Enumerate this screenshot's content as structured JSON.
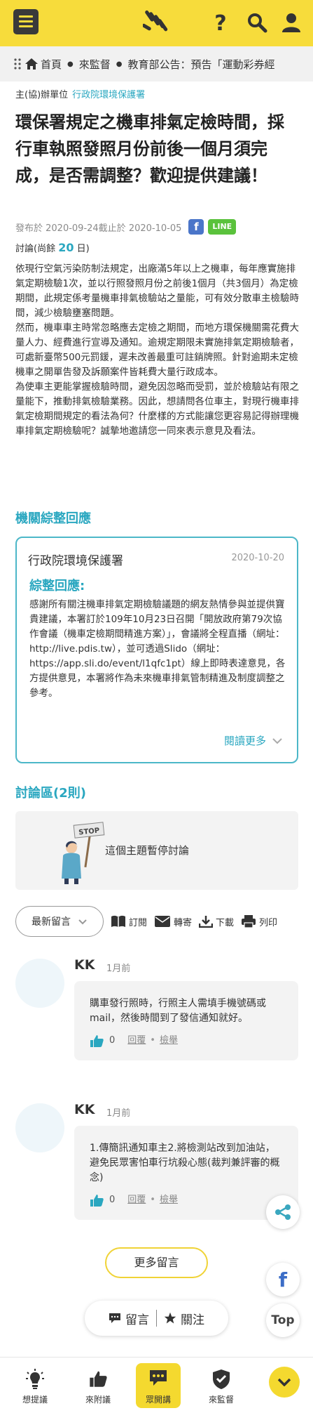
{
  "header": {
    "logo_icon": "hand-logo-icon",
    "accent": "#f7dc3b"
  },
  "breadcrumb": {
    "home": "首頁",
    "section": "來監督",
    "current": "教育部公告：預告「運動彩券經"
  },
  "org": {
    "label": "主(協)辦單位",
    "name": "行政院環境保護署"
  },
  "title": "環保署規定之機車排氣定檢時間，採行車執照發照月份前後一個月須完成，是否需調整？歡迎提供建議！",
  "meta": {
    "published": "發布於 2020-09-24截止於 2020-10-05",
    "fb": "f",
    "line": "LINE"
  },
  "discuss": {
    "prefix": "討論(尚餘 ",
    "days": "20",
    "suffix": " 日)"
  },
  "body": [
    "依現行空氣污染防制法規定，出廠滿5年以上之機車，每年應實施排氣定期檢驗1次，並以行照發照月份之前後1個月（共3個月）為定檢期間，此規定係考量機車排氣檢驗站之量能，可有效分散車主檢驗時間，減少檢驗壅塞問題。",
    "然而，機車車主時常忽略應去定檢之期間，而地方環保機關需花費大量人力、經費進行宣導及通知。逾規定期限未實施排氣定期檢驗者，可處新臺幣500元罰鍰，遲未改善最重可註銷牌照。針對逾期未定檢機車之開單告發及訴願案件皆耗費大量行政成本。",
    "為使車主更能掌握檢驗時間，避免因忽略而受罰，並於檢驗站有限之量能下，推動排氣檢驗業務。因此，想請問各位車主，對現行機車排氣定檢期間規定的看法為何？什麼樣的方式能讓您更容易記得辦理機車排氣定期檢驗呢？誠摯地邀請您一同來表示意見及看法。"
  ],
  "response": {
    "section_title": "機關綜整回應",
    "org": "行政院環境保護署",
    "date": "2020-10-20",
    "label": "綜整回應:",
    "text": "感謝所有關注機車排氣定期檢驗議題的網友熱情參與並提供寶貴建議，本署訂於109年10月23日召開「開放政府第79次協作會議（機車定檢期間精進方案）」，會議將全程直播（網址：http://live.pdis.tw），並可透過Slido（網址：https://app.sli.do/event/l1qfc1pt）線上即時表達意見，各方提供意見，本署將作為未來機車排氣管制精進及制度調整之參考。",
    "read_more": "閱讀更多"
  },
  "discussion": {
    "section_title": "討論區(2則)",
    "paused_text": "這個主題暫停討論",
    "stop_sign": "STOP"
  },
  "toolbar": {
    "sort": "最新留言",
    "subscribe": "訂閱",
    "forward": "轉寄",
    "download": "下載",
    "print": "列印"
  },
  "comments": [
    {
      "name": "KK",
      "time": "1月前",
      "text": "購車發行照時，行照主人需填手機號碼或mail，然後時間到了發信通知就好。",
      "likes": "0",
      "reply": "回覆",
      "report": "檢舉"
    },
    {
      "name": "KK",
      "time": "1月前",
      "text": "1.傳簡訊通知車主2.將檢測站改到加油站，避免民眾害怕車行坑殺心態(裁判兼評審的概念)",
      "likes": "0",
      "reply": "回覆",
      "report": "檢舉"
    }
  ],
  "more_comments": "更多留言",
  "action_pill": {
    "comment": "留言",
    "follow": "關注"
  },
  "floating": {
    "share_icon": "share-icon",
    "fb": "f",
    "top": "Top"
  },
  "bottom_nav": [
    {
      "label": "想提議",
      "icon": "lightbulb-icon"
    },
    {
      "label": "來附議",
      "icon": "thumbs-up-icon"
    },
    {
      "label": "眾開講",
      "icon": "chat-icon"
    },
    {
      "label": "來監督",
      "icon": "shield-check-icon"
    }
  ]
}
